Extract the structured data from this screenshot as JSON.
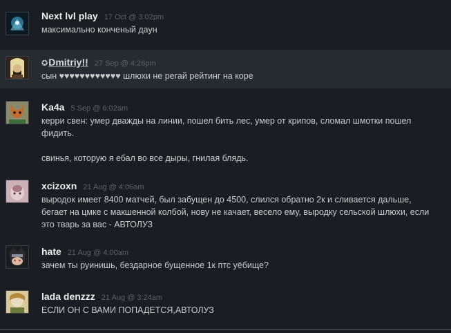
{
  "comments": [
    {
      "author": "Next lvl play",
      "time": "17 Oct @ 3:02pm",
      "text": "максимально конченый даун"
    },
    {
      "badge": "✪",
      "author": "Dmitriy!!",
      "time": "27 Sep @ 4:26pm",
      "text": "сын ♥♥♥♥♥♥♥♥♥♥♥♥ шлюхи не регай рейтинг на коре"
    },
    {
      "author": "Ka4a",
      "time": "5 Sep @ 6:02am",
      "text": "керри свен: умер дважды на линии, пошел бить лес, умер от крипов, сломал шмотки пошел\nфидить.\n\nсвинья, которую я ебал во все дыры, гнилая блядь."
    },
    {
      "author": "xcizoxn",
      "time": "21 Aug @ 4:06am",
      "text": "выродок имеет 8400 матчей, был забущен до 4500, слился обратно 2к и сливается дальше,\nбегает на цмке с макшенной колбой, нову не качает, весело ему, выродку сельской шлюхи, если\nэто тварь за вас - АВТОЛУЗ"
    },
    {
      "author": "hate",
      "time": "21 Aug @ 4:00am",
      "text": "зачем ты руинишь, бездарное бущенное 1к птс уёбище?"
    },
    {
      "author": "lada denzzz",
      "time": "21 Aug @ 3:24am",
      "text": "ЕСЛИ ОН С ВАМИ ПОПАДЕТСЯ,АВТОЛУЗ"
    }
  ]
}
